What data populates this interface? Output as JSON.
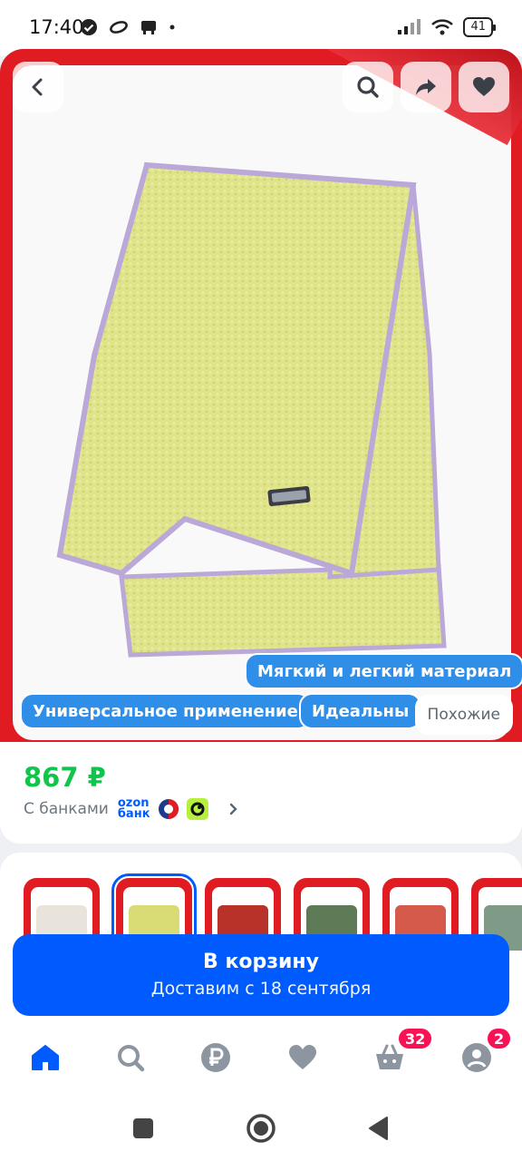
{
  "status_bar": {
    "time": "17:40",
    "battery": "41"
  },
  "hero": {
    "badges": [
      "Мягкий и легкий материал",
      "Универсальное применение",
      "Идеальны"
    ],
    "similar_label": "Похожие"
  },
  "product": {
    "price": "867 ₽",
    "banks_label": "С банками",
    "ozon_bank": "ozon банк"
  },
  "variants": [
    {
      "color": "#e8e4dc"
    },
    {
      "color": "#d9dc74"
    },
    {
      "color": "#b8322a"
    },
    {
      "color": "#5e7a56"
    },
    {
      "color": "#d65a4c"
    },
    {
      "color": "#7f9a86"
    }
  ],
  "cart": {
    "title": "В корзину",
    "subtitle": "Доставим с 18 сентября"
  },
  "tabs": {
    "cart_count": "32",
    "profile_count": "2"
  },
  "colors": {
    "accent": "#005bff",
    "price": "#10c44c",
    "badge": "#f91155"
  }
}
